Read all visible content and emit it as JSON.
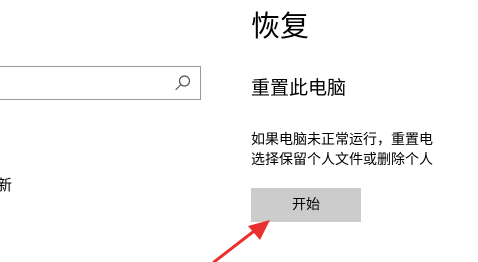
{
  "left_pane": {
    "search": {
      "value": "",
      "icon": "search-icon"
    },
    "nav_fragment": "新"
  },
  "main": {
    "title": "恢复",
    "reset_section": {
      "title": "重置此电脑",
      "description_lines": [
        "如果电脑未正常运行，重置电",
        "选择保留个人文件或删除个人"
      ],
      "start_button_label": "开始"
    }
  },
  "annotation": {
    "arrow_color": "#e8312f",
    "icon": "arrow-icon"
  },
  "colors": {
    "background": "#ffffff",
    "button_bg": "#cccccc",
    "search_border": "#9a9a9a"
  }
}
